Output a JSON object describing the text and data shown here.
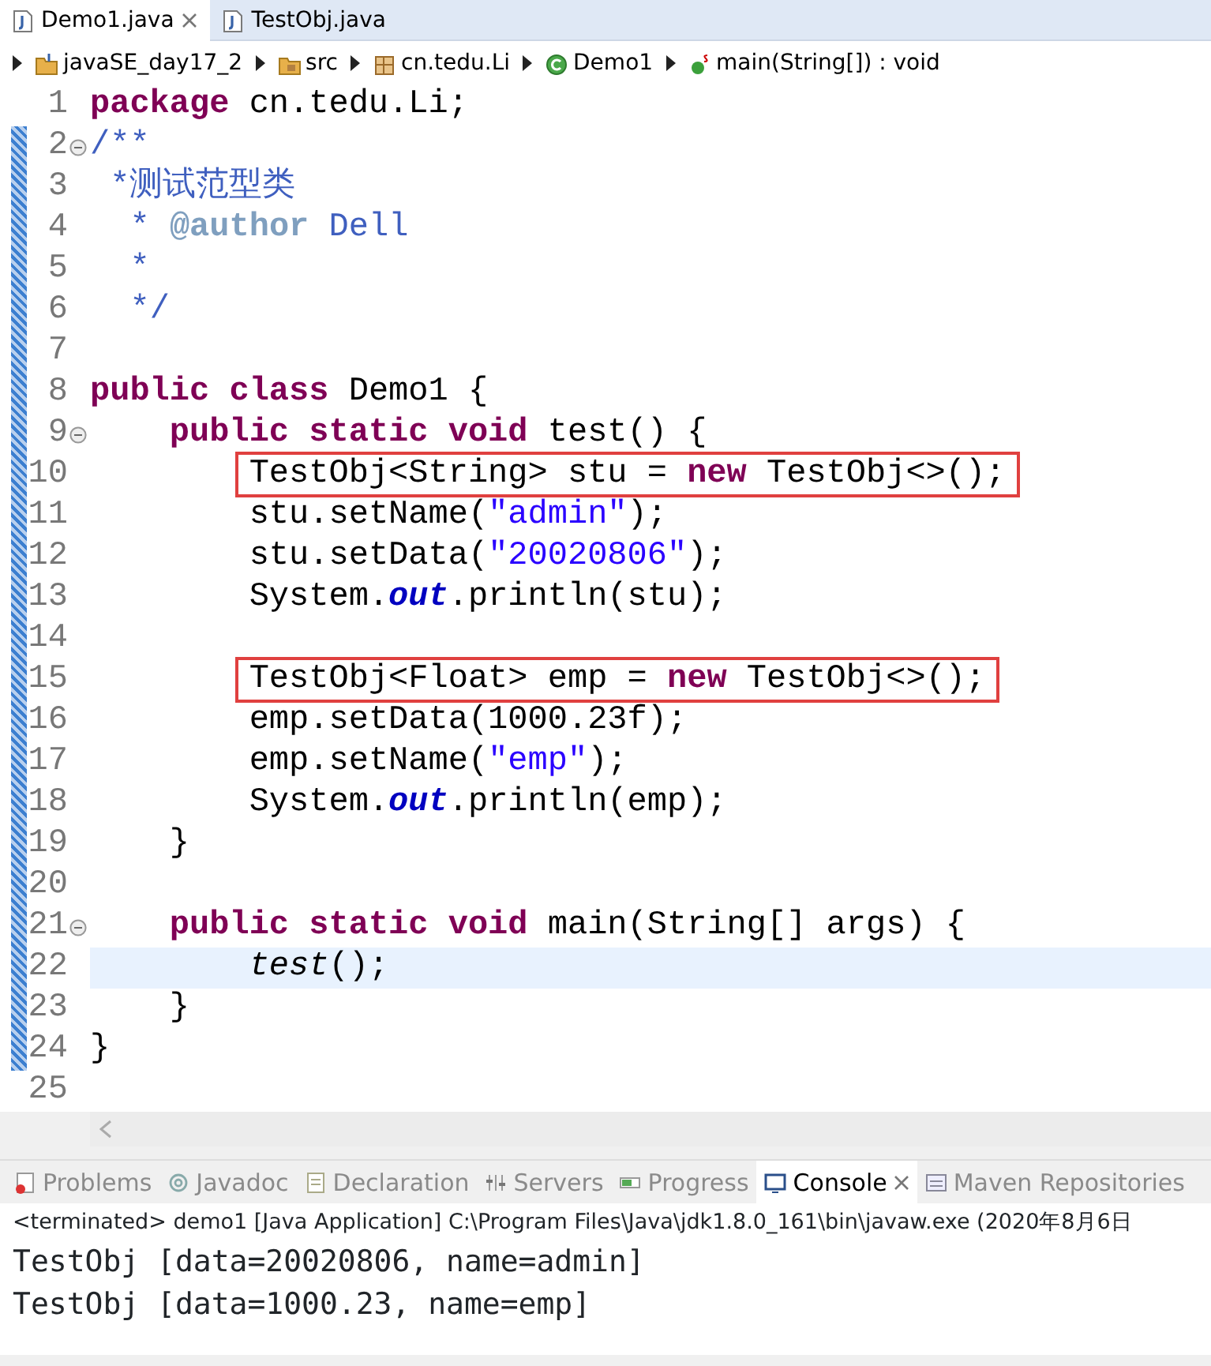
{
  "editor_tabs": [
    {
      "label": "Demo1.java",
      "selected": true
    },
    {
      "label": "TestObj.java",
      "selected": false
    }
  ],
  "breadcrumb": [
    {
      "label": "javaSE_day17_2",
      "kind": "project"
    },
    {
      "label": "src",
      "kind": "folder"
    },
    {
      "label": "cn.tedu.Li",
      "kind": "package"
    },
    {
      "label": "Demo1",
      "kind": "class"
    },
    {
      "label": "main(String[]) : void",
      "kind": "method"
    }
  ],
  "code_lines": [
    {
      "number": "1",
      "foldable": false,
      "boxed": false,
      "current": false,
      "tokens": [
        {
          "kind": "kw",
          "t": "package"
        },
        {
          "kind": "plain",
          "t": " cn.tedu.Li;"
        }
      ]
    },
    {
      "number": "2",
      "foldable": true,
      "boxed": false,
      "current": false,
      "tokens": [
        {
          "kind": "doc",
          "t": "/**"
        }
      ]
    },
    {
      "number": "3",
      "foldable": false,
      "boxed": false,
      "current": false,
      "tokens": [
        {
          "kind": "doc",
          "t": " *测试范型类"
        }
      ]
    },
    {
      "number": "4",
      "foldable": false,
      "boxed": false,
      "current": false,
      "tokens": [
        {
          "kind": "doc",
          "t": "  * "
        },
        {
          "kind": "tag",
          "t": "@author"
        },
        {
          "kind": "doc",
          "t": " Dell"
        }
      ]
    },
    {
      "number": "5",
      "foldable": false,
      "boxed": false,
      "current": false,
      "tokens": [
        {
          "kind": "doc",
          "t": "  *"
        }
      ]
    },
    {
      "number": "6",
      "foldable": false,
      "boxed": false,
      "current": false,
      "tokens": [
        {
          "kind": "doc",
          "t": "  */"
        }
      ]
    },
    {
      "number": "7",
      "foldable": false,
      "boxed": false,
      "current": false
    },
    {
      "number": "8",
      "foldable": false,
      "boxed": false,
      "current": false,
      "tokens": [
        {
          "kind": "kw",
          "t": "public class"
        },
        {
          "kind": "plain",
          "t": " Demo1 {"
        }
      ]
    },
    {
      "number": "9",
      "foldable": true,
      "boxed": false,
      "current": false,
      "tokens": [
        {
          "kind": "kw",
          "t": "    public static void"
        },
        {
          "kind": "plain",
          "t": " test() {"
        }
      ]
    },
    {
      "number": "10",
      "foldable": false,
      "boxed": true,
      "current": false,
      "tokens": [
        {
          "kind": "plain",
          "t": "        TestObj<String> stu = "
        },
        {
          "kind": "kw",
          "t": "new"
        },
        {
          "kind": "plain",
          "t": " TestObj<>();"
        }
      ]
    },
    {
      "number": "11",
      "foldable": false,
      "boxed": false,
      "current": false,
      "tokens": [
        {
          "kind": "plain",
          "t": "        stu.setName("
        },
        {
          "kind": "str",
          "t": "\"admin\""
        },
        {
          "kind": "plain",
          "t": ");"
        }
      ]
    },
    {
      "number": "12",
      "foldable": false,
      "boxed": false,
      "current": false,
      "tokens": [
        {
          "kind": "plain",
          "t": "        stu.setData("
        },
        {
          "kind": "str",
          "t": "\"20020806\""
        },
        {
          "kind": "plain",
          "t": ");"
        }
      ]
    },
    {
      "number": "13",
      "foldable": false,
      "boxed": false,
      "current": false,
      "tokens": [
        {
          "kind": "plain",
          "t": "        System."
        },
        {
          "kind": "field",
          "t": "out"
        },
        {
          "kind": "plain",
          "t": ".println(stu);"
        }
      ]
    },
    {
      "number": "14",
      "foldable": false,
      "boxed": false,
      "current": false
    },
    {
      "number": "15",
      "foldable": false,
      "boxed": true,
      "current": false,
      "tokens": [
        {
          "kind": "plain",
          "t": "        TestObj<Float> emp = "
        },
        {
          "kind": "kw",
          "t": "new"
        },
        {
          "kind": "plain",
          "t": " TestObj<>();"
        }
      ]
    },
    {
      "number": "16",
      "foldable": false,
      "boxed": false,
      "current": false,
      "tokens": [
        {
          "kind": "plain",
          "t": "        emp.setData(1000.23f);"
        }
      ]
    },
    {
      "number": "17",
      "foldable": false,
      "boxed": false,
      "current": false,
      "tokens": [
        {
          "kind": "plain",
          "t": "        emp.setName("
        },
        {
          "kind": "str",
          "t": "\"emp\""
        },
        {
          "kind": "plain",
          "t": ");"
        }
      ]
    },
    {
      "number": "18",
      "foldable": false,
      "boxed": false,
      "current": false,
      "tokens": [
        {
          "kind": "plain",
          "t": "        System."
        },
        {
          "kind": "field",
          "t": "out"
        },
        {
          "kind": "plain",
          "t": ".println(emp);"
        }
      ]
    },
    {
      "number": "19",
      "foldable": false,
      "boxed": false,
      "current": false,
      "tokens": [
        {
          "kind": "plain",
          "t": "    }"
        }
      ]
    },
    {
      "number": "20",
      "foldable": false,
      "boxed": false,
      "current": false
    },
    {
      "number": "21",
      "foldable": true,
      "boxed": false,
      "current": false,
      "tokens": [
        {
          "kind": "kw",
          "t": "    public static void"
        },
        {
          "kind": "plain",
          "t": " main(String[] args) {"
        }
      ]
    },
    {
      "number": "22",
      "foldable": false,
      "boxed": false,
      "current": true,
      "tokens": [
        {
          "kind": "call",
          "t": "        test"
        },
        {
          "kind": "plain",
          "t": "();"
        }
      ]
    },
    {
      "number": "23",
      "foldable": false,
      "boxed": false,
      "current": false,
      "tokens": [
        {
          "kind": "plain",
          "t": "    }"
        }
      ]
    },
    {
      "number": "24",
      "foldable": false,
      "boxed": false,
      "current": false,
      "tokens": [
        {
          "kind": "plain",
          "t": "}"
        }
      ]
    },
    {
      "number": "25",
      "foldable": false,
      "boxed": false,
      "current": false
    }
  ],
  "view_tabs": [
    {
      "label": "Problems",
      "kind": "problems",
      "selected": false
    },
    {
      "label": "Javadoc",
      "kind": "javadoc",
      "selected": false
    },
    {
      "label": "Declaration",
      "kind": "declaration",
      "selected": false
    },
    {
      "label": "Servers",
      "kind": "servers",
      "selected": false
    },
    {
      "label": "Progress",
      "kind": "progress",
      "selected": false
    },
    {
      "label": "Console",
      "kind": "console",
      "selected": true
    },
    {
      "label": "Maven Repositories",
      "kind": "maven",
      "selected": false
    }
  ],
  "console": {
    "status": "<terminated> demo1 [Java Application] C:\\Program Files\\Java\\jdk1.8.0_161\\bin\\javaw.exe (2020年8月6日",
    "output": [
      "TestObj [data=20020806, name=admin]",
      "TestObj [data=1000.23, name=emp]"
    ]
  }
}
